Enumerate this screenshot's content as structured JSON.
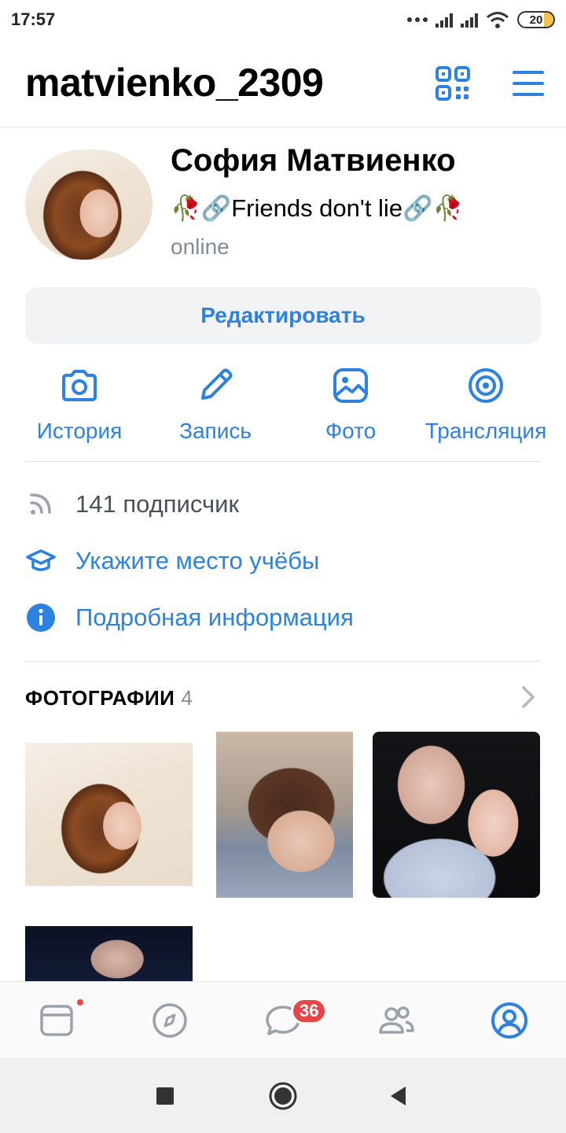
{
  "status_bar": {
    "time": "17:57",
    "battery": "20"
  },
  "header": {
    "username": "matvienko_2309"
  },
  "profile": {
    "name": "София Матвиенко",
    "status": "🥀🔗Friends don't lie🔗🥀",
    "online": "online"
  },
  "edit_button": {
    "label": "Редактировать"
  },
  "actions": [
    {
      "label": "История",
      "icon": "camera-icon"
    },
    {
      "label": "Запись",
      "icon": "pencil-icon"
    },
    {
      "label": "Фото",
      "icon": "image-icon"
    },
    {
      "label": "Трансляция",
      "icon": "broadcast-icon"
    }
  ],
  "info": {
    "followers": "141 подписчик",
    "education": "Укажите место учёбы",
    "details": "Подробная информация"
  },
  "photos": {
    "title": "ФОТОГРАФИИ",
    "count": "4"
  },
  "tabbar": {
    "messages_badge": "36",
    "items": [
      "news-icon",
      "explore-icon",
      "messages-icon",
      "friends-icon",
      "profile-icon"
    ]
  },
  "colors": {
    "accent": "#2d81e0",
    "badge": "#e64646",
    "secondary_text": "#818c99"
  }
}
